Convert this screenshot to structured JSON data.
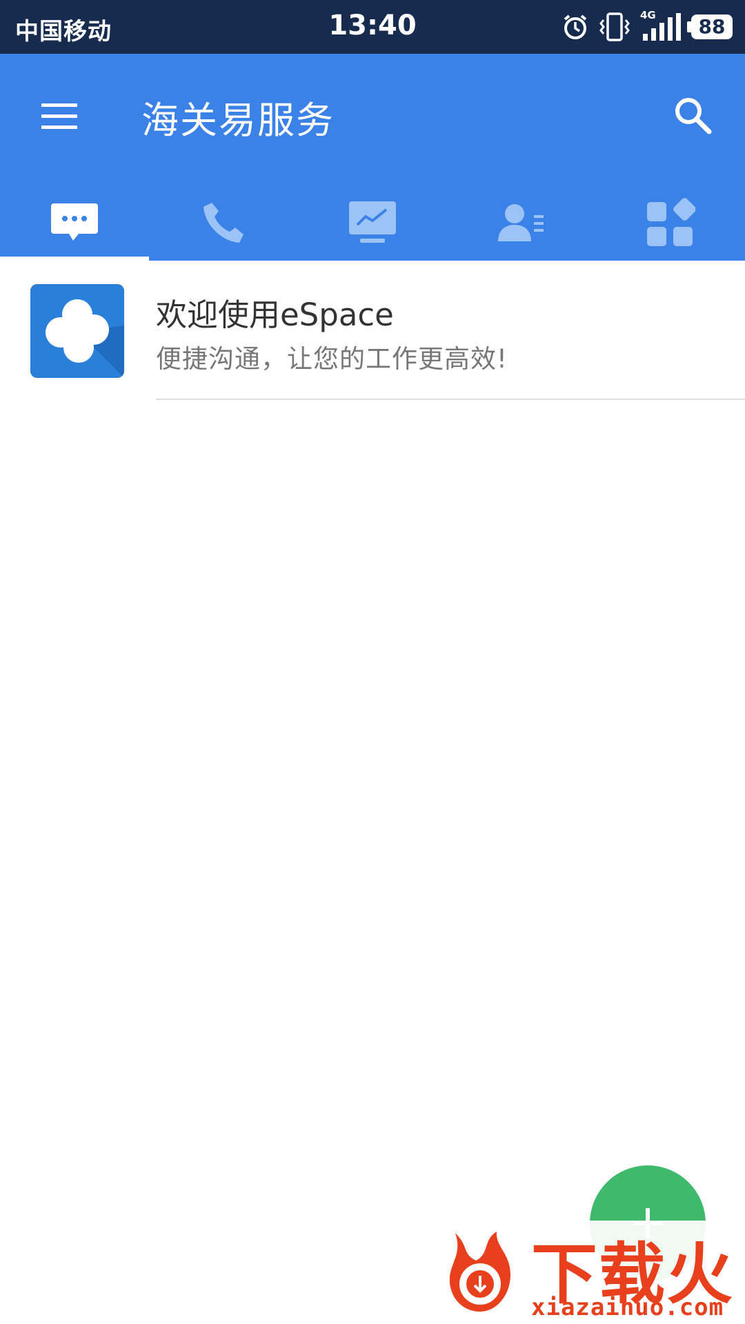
{
  "status_bar": {
    "carrier": "中国移动",
    "time": "13:40",
    "network": "4G",
    "battery": "88"
  },
  "app_bar": {
    "title": "海关易服务"
  },
  "tabs": [
    {
      "icon": "chat-bubble-icon",
      "selected": true
    },
    {
      "icon": "phone-icon",
      "selected": false
    },
    {
      "icon": "monitor-chart-icon",
      "selected": false
    },
    {
      "icon": "contacts-icon",
      "selected": false
    },
    {
      "icon": "apps-grid-icon",
      "selected": false
    }
  ],
  "conversations": [
    {
      "title": "欢迎使用eSpace",
      "subtitle": "便捷沟通，让您的工作更高效!"
    }
  ],
  "watermark": {
    "brand": "下载火",
    "url": "xiazaihuo.com"
  },
  "colors": {
    "status_bar": "#172b4e",
    "app_bar": "#3b82e8",
    "fab": "#3dba6b",
    "watermark": "#e8401c"
  }
}
